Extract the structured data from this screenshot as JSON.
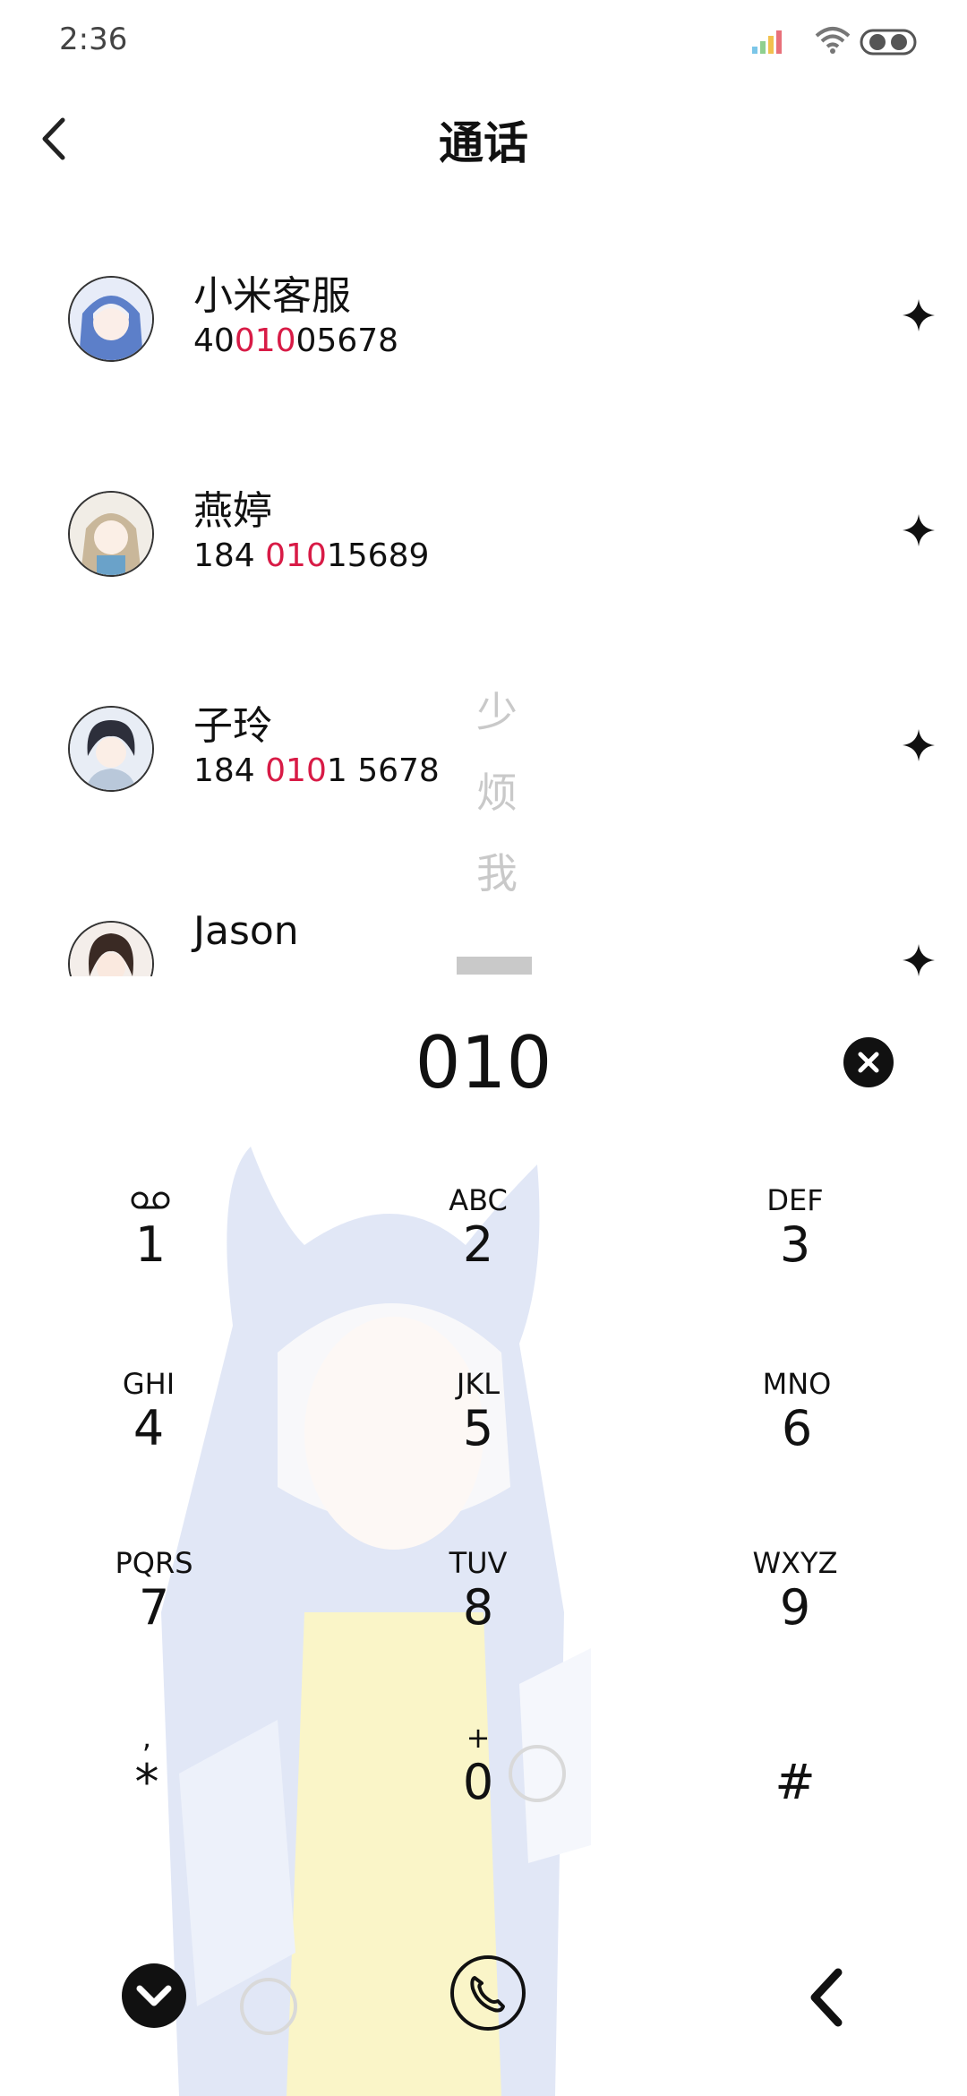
{
  "status_bar": {
    "time": "2:36"
  },
  "header": {
    "title": "通话"
  },
  "contacts": [
    {
      "name": "小米客服",
      "number_pre": "40",
      "number_match": "010",
      "number_post": "05678"
    },
    {
      "name": "燕婷",
      "number_pre": "184 ",
      "number_match": "010",
      "number_post": "15689"
    },
    {
      "name": "子玲",
      "number_pre": "184 ",
      "number_match": "010",
      "number_post": "1 5678"
    },
    {
      "name": "Jason",
      "number_pre": "",
      "number_match": "",
      "number_post": ""
    }
  ],
  "side_index": [
    "少",
    "烦",
    "我"
  ],
  "dialer": {
    "input": "010",
    "keys": [
      {
        "letters": "",
        "digit": "1"
      },
      {
        "letters": "ABC",
        "digit": "2"
      },
      {
        "letters": "DEF",
        "digit": "3"
      },
      {
        "letters": "GHI",
        "digit": "4"
      },
      {
        "letters": "JKL",
        "digit": "5"
      },
      {
        "letters": "MNO",
        "digit": "6"
      },
      {
        "letters": "PQRS",
        "digit": "7"
      },
      {
        "letters": "TUV",
        "digit": "8"
      },
      {
        "letters": "WXYZ",
        "digit": "9"
      },
      {
        "letters": ",",
        "digit": "*"
      },
      {
        "letters": "+",
        "digit": "0"
      },
      {
        "letters": "",
        "digit": "#"
      }
    ]
  },
  "colors": {
    "highlight": "#d81b46",
    "index_gray": "#c9c9c9"
  },
  "icons": {
    "back": "chevron-left-icon",
    "star": "sparkle-icon",
    "clear": "clear-circle-icon",
    "collapse": "chevron-down-circle-icon",
    "call": "phone-icon",
    "backspace": "chevron-left-icon"
  }
}
